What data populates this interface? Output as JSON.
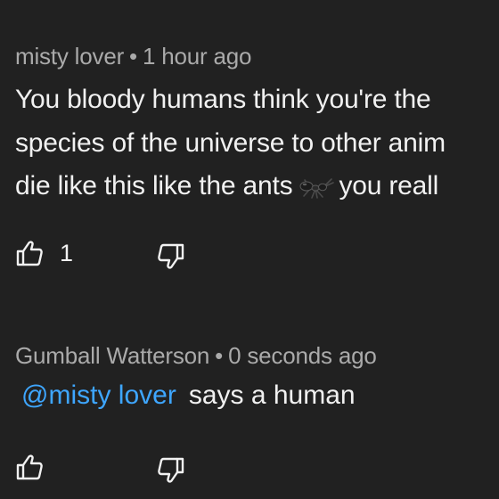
{
  "comments": [
    {
      "author": "misty lover",
      "separator": "•",
      "time": "1 hour ago",
      "lines": [
        "You bloody humans think you're the",
        "species of the universe to other anim",
        "die like this like the ants"
      ],
      "line3_tail": "you reall",
      "emoji": "ant-icon",
      "likes": "1"
    },
    {
      "author": "Gumball Watterson",
      "separator": "•",
      "time": "0 seconds ago",
      "mention": "@misty lover",
      "text": "says a human"
    }
  ],
  "colors": {
    "background": "#212121",
    "text": "#f1f1f1",
    "meta": "#aaaaaa",
    "mention": "#3ea6ff"
  }
}
